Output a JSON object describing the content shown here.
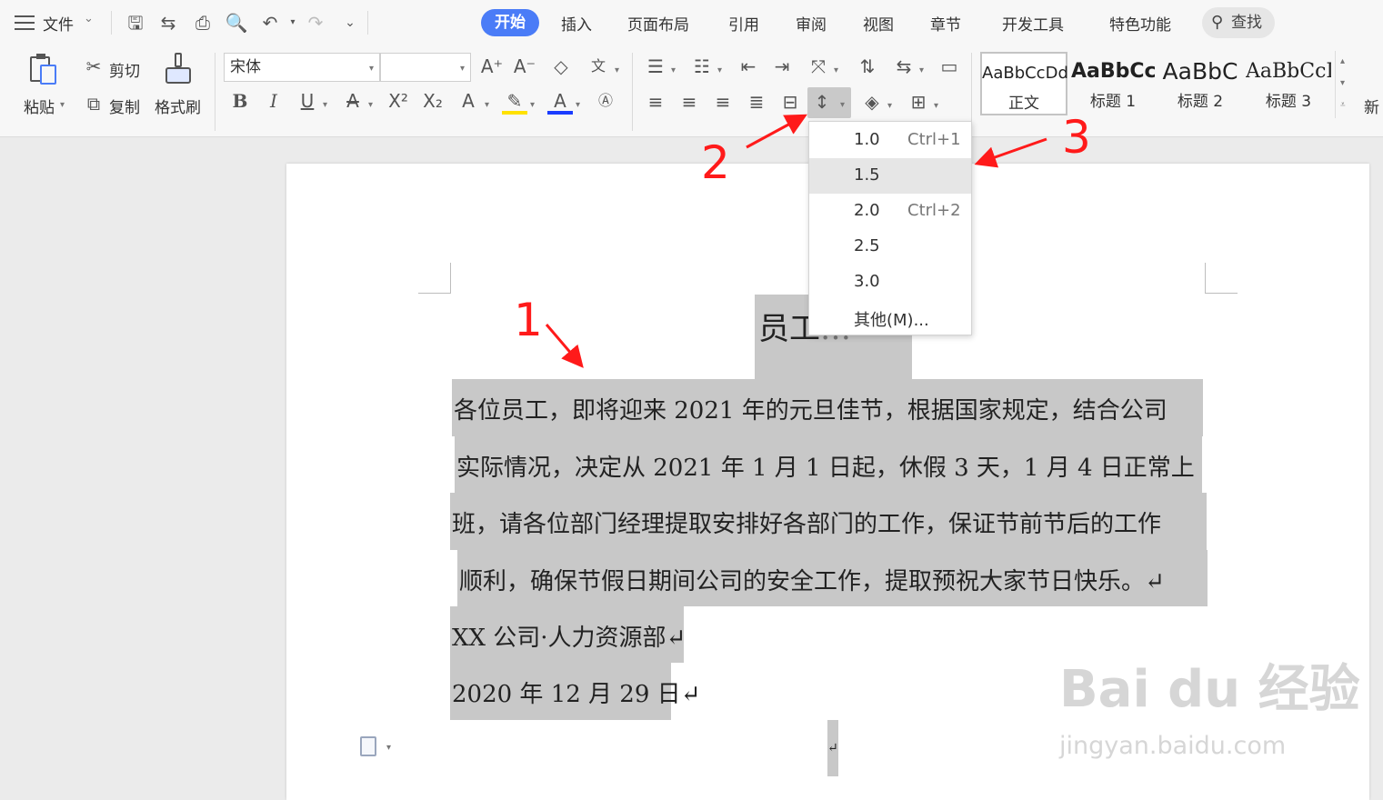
{
  "menubar": {
    "file_label": "文件",
    "tabs": [
      "开始",
      "插入",
      "页面布局",
      "引用",
      "审阅",
      "视图",
      "章节",
      "开发工具",
      "特色功能"
    ],
    "search_label": "查找"
  },
  "ribbon": {
    "paste_label": "粘贴",
    "cut_label": "剪切",
    "copy_label": "复制",
    "format_painter_label": "格式刷",
    "font_name": "宋体",
    "font_size": "",
    "styles": [
      {
        "sample": "AaBbCcDd",
        "name": "正文"
      },
      {
        "sample": "AaBbCc",
        "name": "标题 1"
      },
      {
        "sample": "AaBbC",
        "name": "标题 2"
      },
      {
        "sample": "AaBbCcI",
        "name": "标题 3"
      }
    ],
    "new_style_partial": "新"
  },
  "line_spacing_menu": {
    "items": [
      {
        "value": "1.0",
        "shortcut": "Ctrl+1"
      },
      {
        "value": "1.5",
        "shortcut": ""
      },
      {
        "value": "2.0",
        "shortcut": "Ctrl+2"
      },
      {
        "value": "2.5",
        "shortcut": ""
      },
      {
        "value": "3.0",
        "shortcut": ""
      },
      {
        "value": "其他(M)...",
        "shortcut": ""
      }
    ],
    "hovered_index": 1
  },
  "document": {
    "title_visible": "员工",
    "title_tail": "…",
    "lines": [
      "各位员工，即将迎来 2021 年的元旦佳节，根据国家规定，结合公司",
      "实际情况，决定从 2021 年 1 月 1 日起，休假 3 天，1 月 4 日正常上",
      "班，请各位部门经理提取安排好各部门的工作，保证节前节后的工作",
      "顺利，确保节假日期间公司的安全工作，提取预祝大家节日快乐。↵",
      "XX 公司·人力资源部↵",
      "2020 年 12 月 29 日↵"
    ],
    "end_mark": "↵"
  },
  "annotations": {
    "step1": "1",
    "step2": "2",
    "step3": "3",
    "color": "#ff1a1a"
  },
  "watermark": {
    "brand": "Bai du 经验",
    "url": "jingyan.baidu.com"
  },
  "colors": {
    "accent": "#4a7cf7",
    "selection": "#c8c8c8"
  }
}
